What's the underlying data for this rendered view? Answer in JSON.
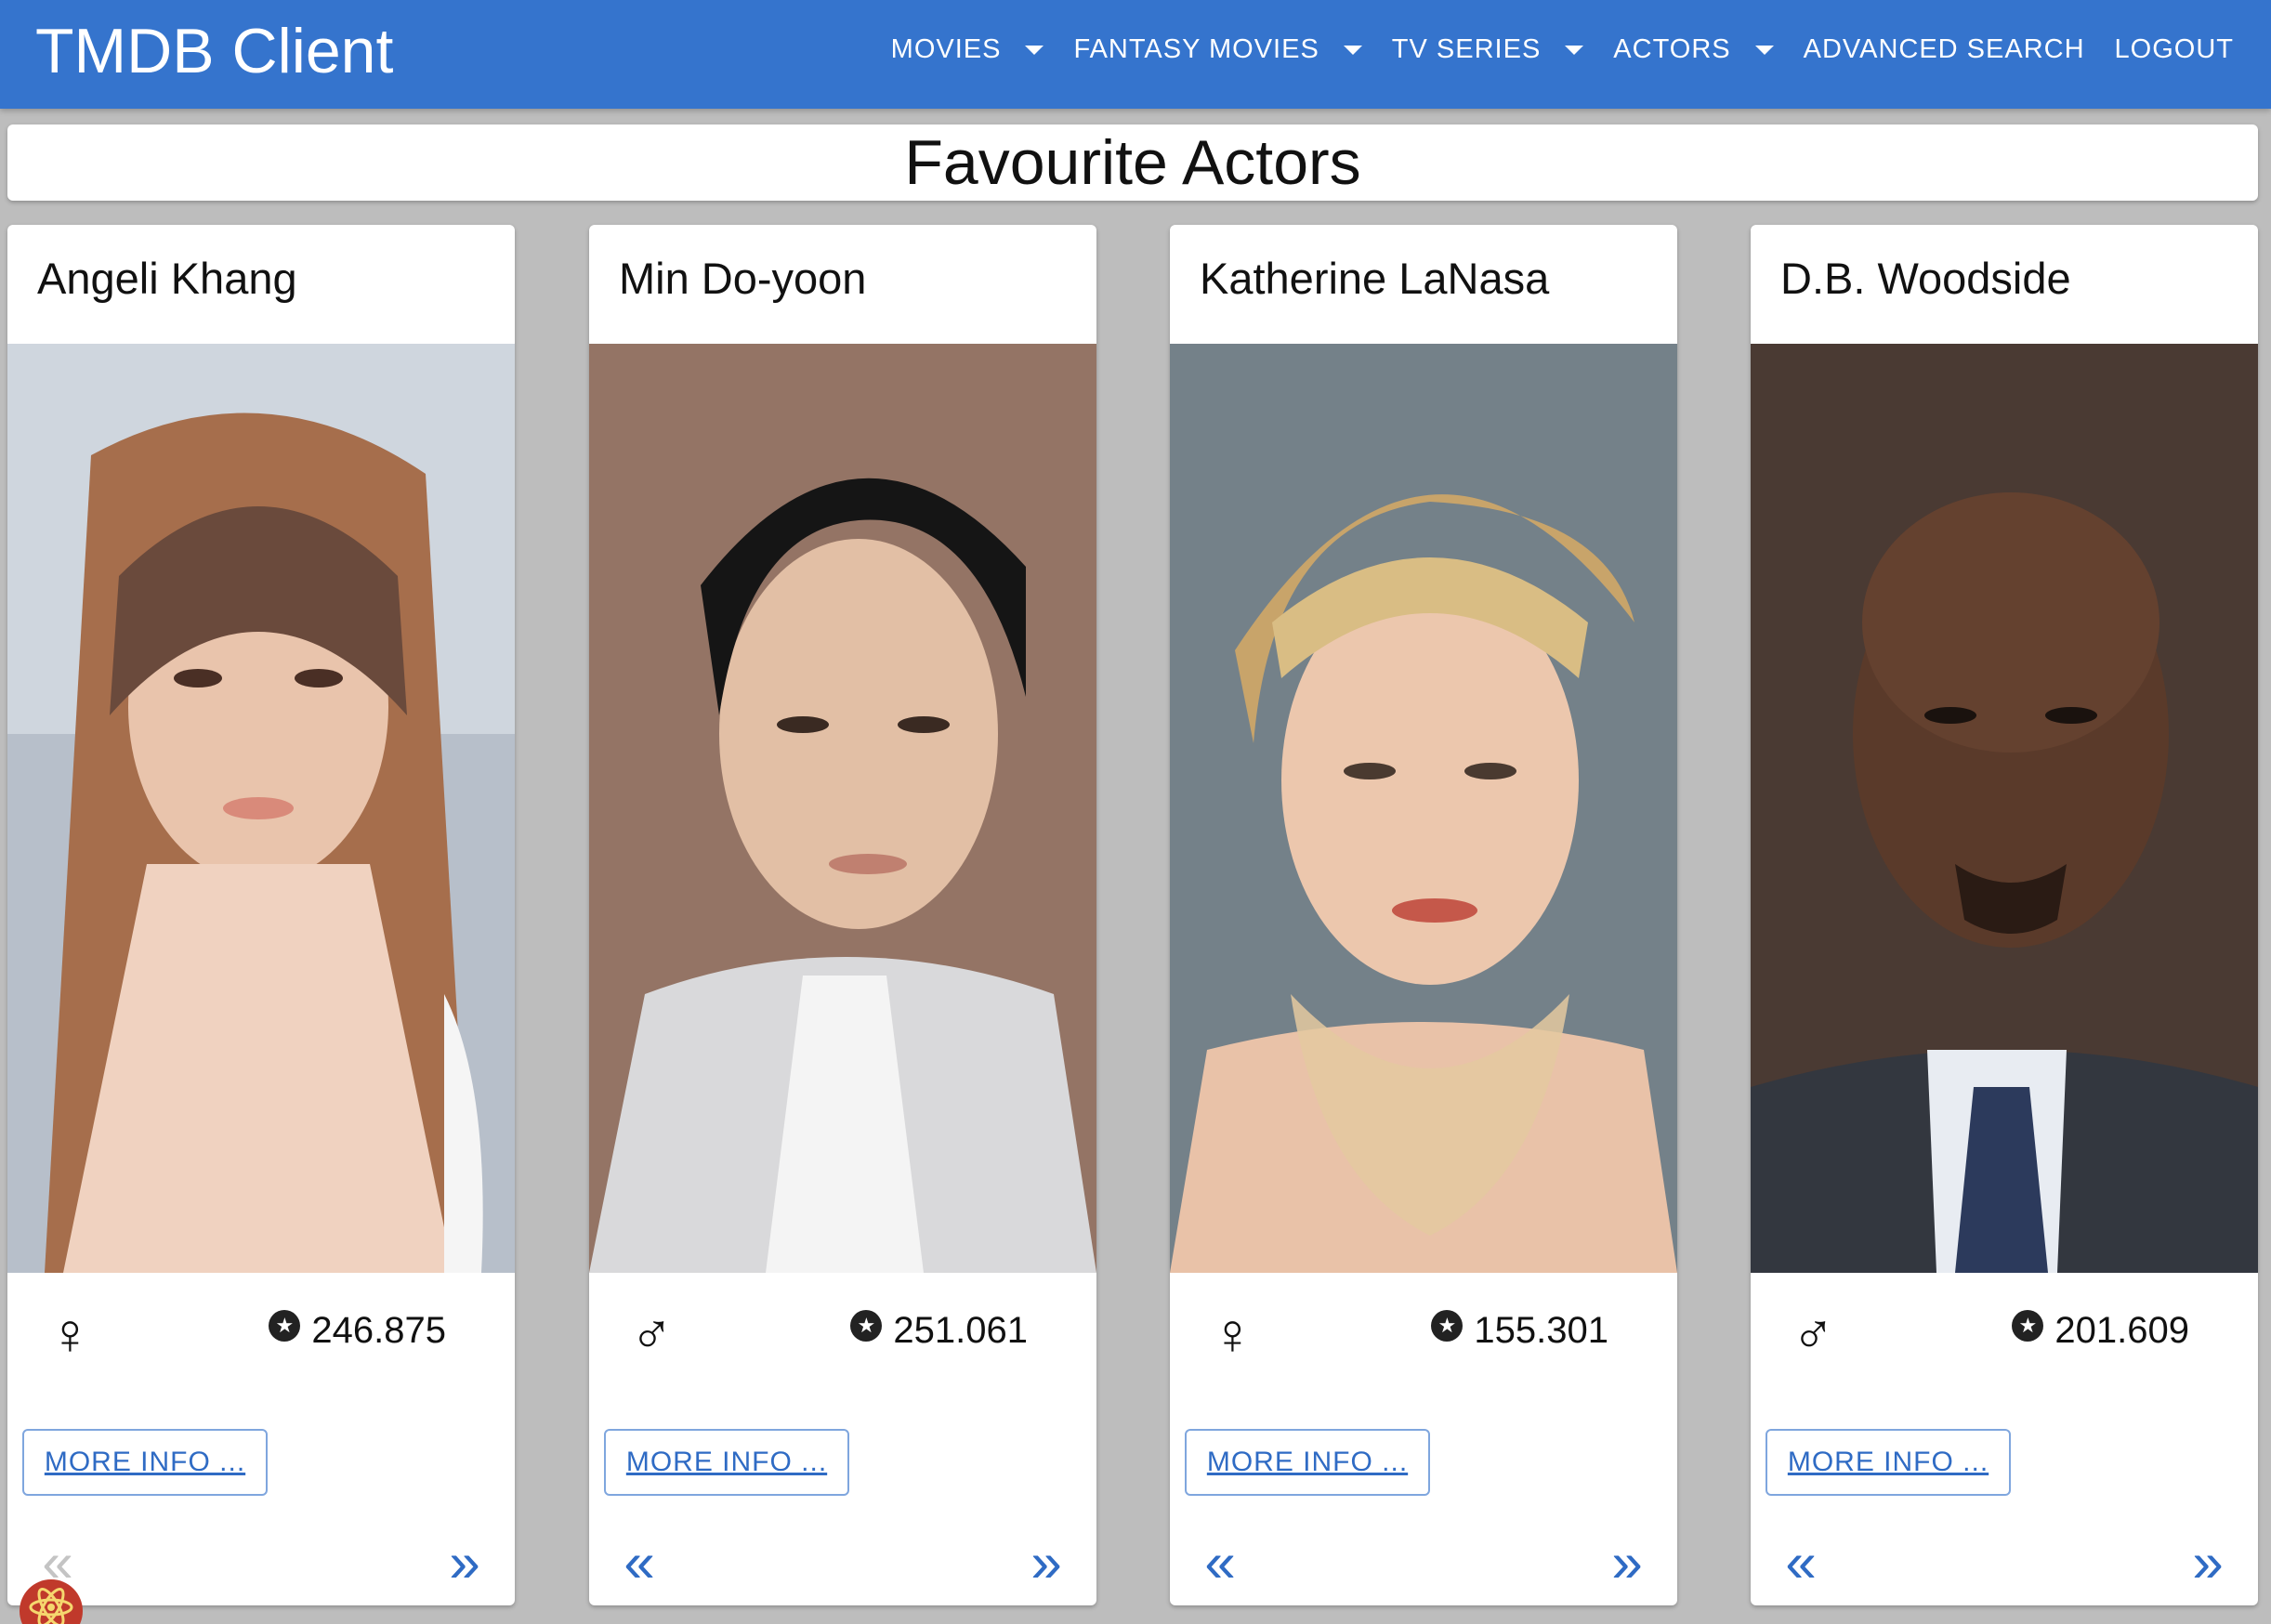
{
  "appbar": {
    "brand": "TMDB Client",
    "nav": [
      {
        "label": "MOVIES",
        "dropdown": true
      },
      {
        "label": "FANTASY MOVIES",
        "dropdown": true
      },
      {
        "label": "TV SERIES",
        "dropdown": true
      },
      {
        "label": "ACTORS",
        "dropdown": true
      },
      {
        "label": "ADVANCED SEARCH",
        "dropdown": false
      },
      {
        "label": "LOGOUT",
        "dropdown": false
      }
    ]
  },
  "page_title": "Favourite Actors",
  "actors": [
    {
      "name": "Angeli Khang",
      "gender_icon": "♀",
      "popularity": "246.875",
      "more_label": "MORE INFO ...",
      "prev": "«",
      "next": "»"
    },
    {
      "name": "Min Do-yoon",
      "gender_icon": "♂",
      "popularity": "251.061",
      "more_label": "MORE INFO ...",
      "prev": "«",
      "next": "»"
    },
    {
      "name": "Katherine LaNasa",
      "gender_icon": "♀",
      "popularity": "155.301",
      "more_label": "MORE INFO ...",
      "prev": "«",
      "next": "»"
    },
    {
      "name": "D.B. Woodside",
      "gender_icon": "♂",
      "popularity": "201.609",
      "more_label": "MORE INFO ...",
      "prev": "«",
      "next": "»"
    }
  ],
  "popularity_icon": "★",
  "colors": {
    "appbar": "#3574cd",
    "accent": "#2f6bc4",
    "background": "#bdbdbd"
  }
}
